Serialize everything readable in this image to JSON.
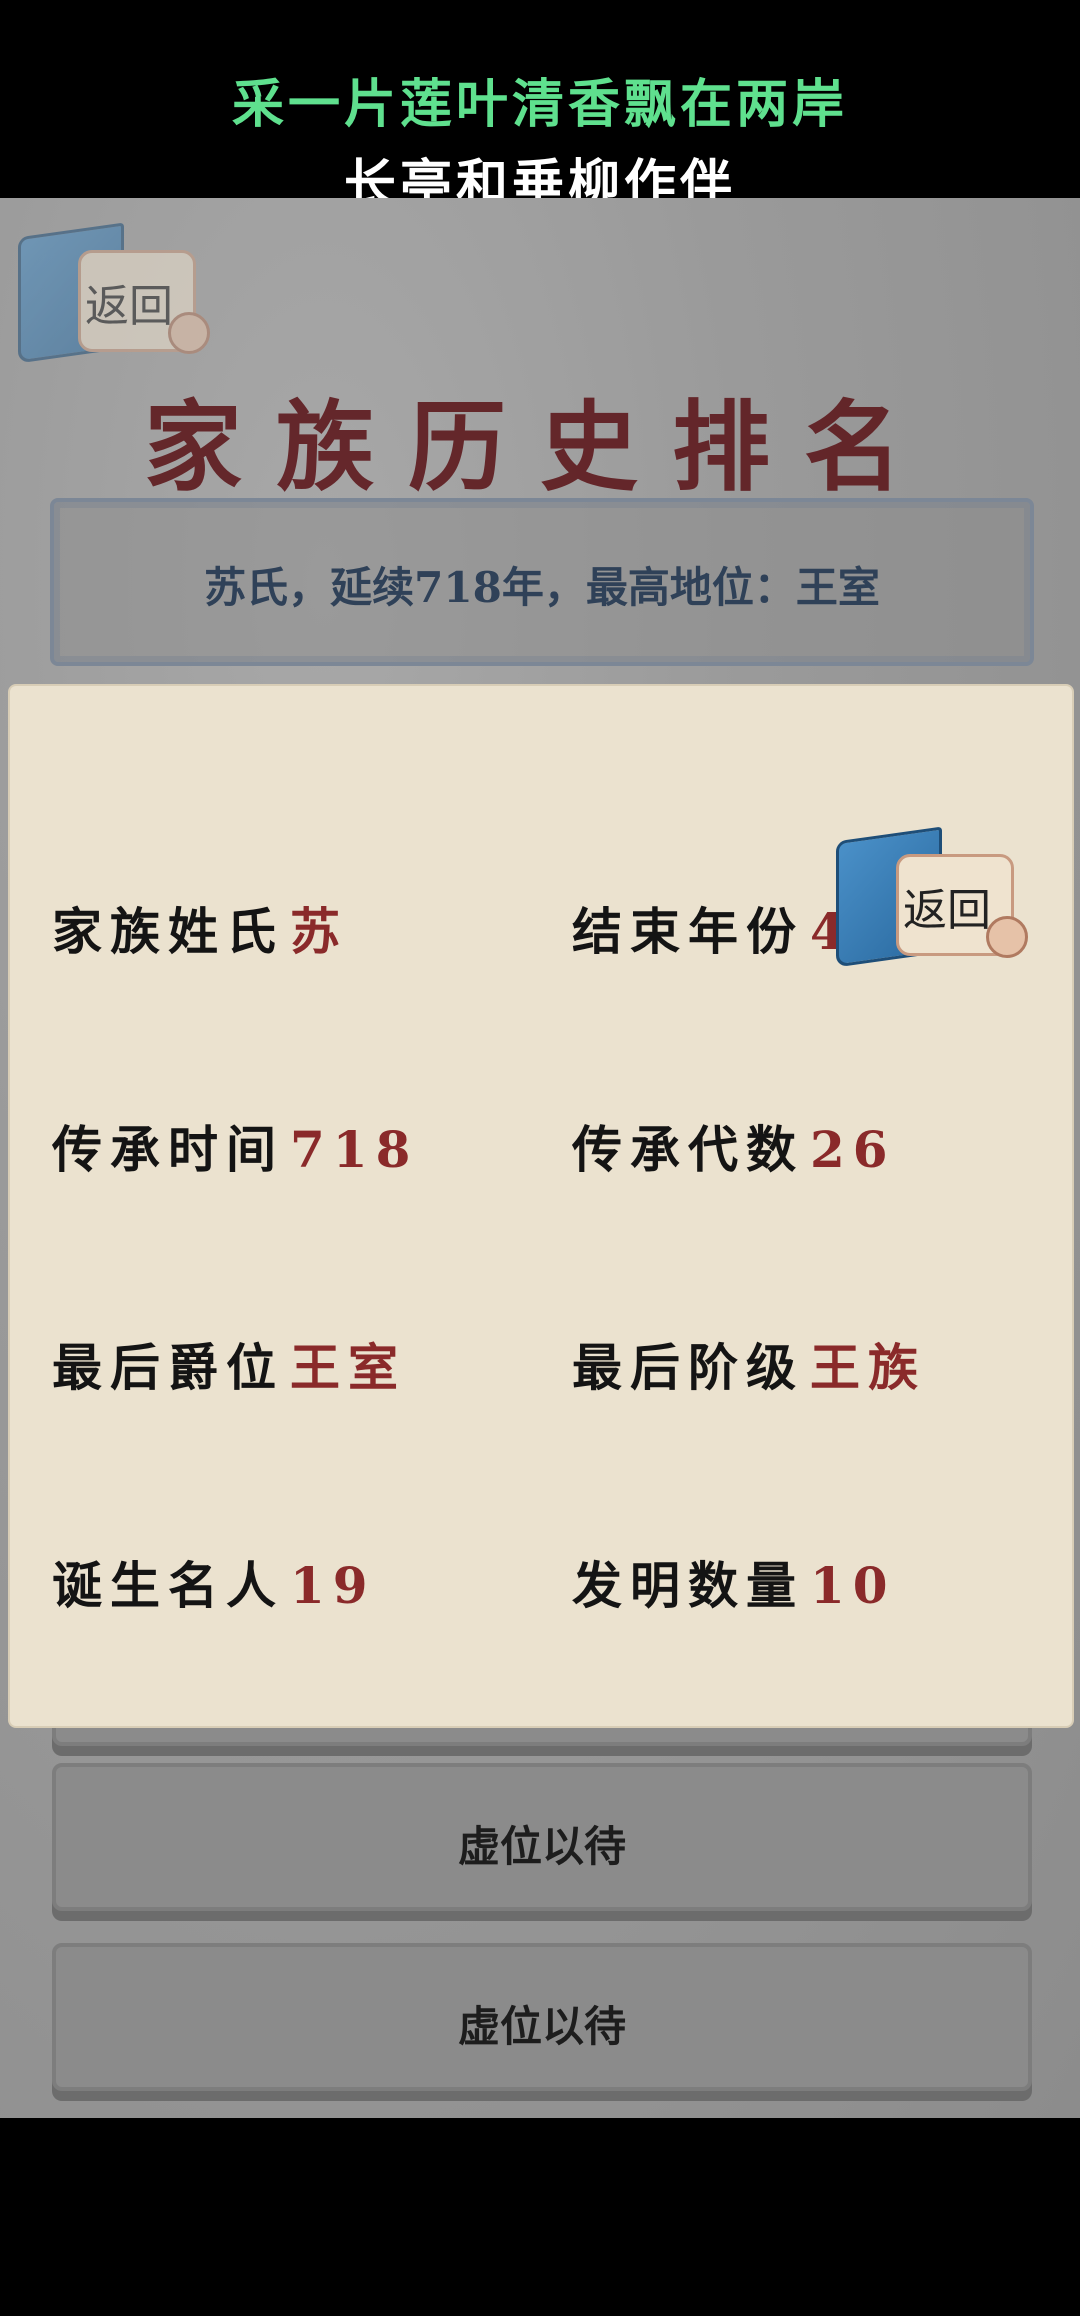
{
  "lyrics": {
    "line1": "采一片莲叶清香飘在两岸",
    "line2": "长亭和垂柳作伴"
  },
  "back_button_label": "返回",
  "page_title": "家族历史排名",
  "summary": "苏氏，延续718年，最高地位：王室",
  "slots": [
    {
      "label": "虚位以待"
    },
    {
      "label": "虚位以待"
    }
  ],
  "detail": {
    "back_label": "返回",
    "stats": [
      {
        "key": "家族姓氏",
        "value": "苏"
      },
      {
        "key": "结束年份",
        "value": "497"
      },
      {
        "key": "传承时间",
        "value": "718"
      },
      {
        "key": "传承代数",
        "value": "26"
      },
      {
        "key": "最后爵位",
        "value": "王室"
      },
      {
        "key": "最后阶级",
        "value": "王族"
      },
      {
        "key": "诞生名人",
        "value": "19"
      },
      {
        "key": "发明数量",
        "value": "10"
      }
    ]
  }
}
